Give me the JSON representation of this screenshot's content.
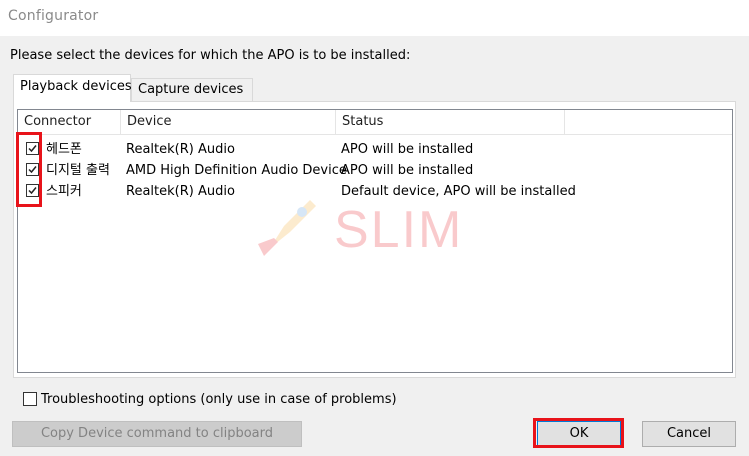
{
  "window": {
    "title": "Configurator"
  },
  "instruction": "Please select the devices for which the APO is to be installed:",
  "tabs": [
    {
      "label": "Playback devices",
      "active": true
    },
    {
      "label": "Capture devices",
      "active": false
    }
  ],
  "table": {
    "columns": [
      "Connector",
      "Device",
      "Status"
    ],
    "rows": [
      {
        "checked": true,
        "connector": "헤드폰",
        "device": "Realtek(R) Audio",
        "status": "APO will be installed"
      },
      {
        "checked": true,
        "connector": "디지털 출력",
        "device": "AMD High Definition Audio Device",
        "status": "APO will be installed"
      },
      {
        "checked": true,
        "connector": "스피커",
        "device": "Realtek(R) Audio",
        "status": "Default device, APO will be installed"
      }
    ]
  },
  "troubleshooting": {
    "label": "Troubleshooting options (only use in case of problems)",
    "checked": false
  },
  "buttons": {
    "copy": "Copy Device command to clipboard",
    "ok": "OK",
    "cancel": "Cancel"
  },
  "watermark": {
    "text": "SLIM"
  },
  "colors": {
    "highlight": "#e8131a",
    "ok_border": "#0078d7"
  }
}
